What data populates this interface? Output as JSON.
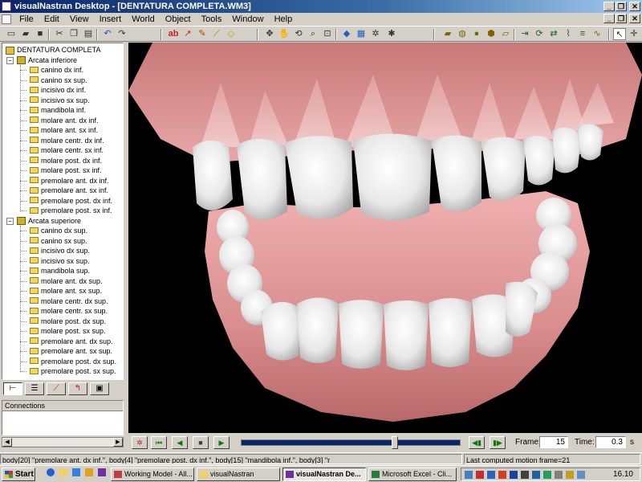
{
  "window": {
    "title": "visualNastran Desktop - [DENTATURA COMPLETA.WM3]",
    "controls": [
      "_",
      "❐",
      "✕"
    ]
  },
  "menubar": {
    "items": [
      "File",
      "Edit",
      "View",
      "Insert",
      "World",
      "Object",
      "Tools",
      "Window",
      "Help"
    ],
    "doc_controls": [
      "_",
      "❐",
      "✕"
    ]
  },
  "tree": {
    "root": "DENTATURA COMPLETA",
    "groups": [
      {
        "label": "Arcata inferiore",
        "items": [
          "canino dx inf.",
          "canino sx sup.",
          "incisivo dx inf.",
          "incisivo sx sup.",
          "mandibola inf.",
          "molare ant. dx inf.",
          "molare ant. sx inf.",
          "molare centr. dx inf.",
          "molare centr. sx inf.",
          "molare post. dx inf.",
          "molare post. sx inf.",
          "premolare ant. dx inf.",
          "premolare ant. sx inf.",
          "premolare post. dx inf.",
          "premolare post. sx inf."
        ]
      },
      {
        "label": "Arcata superiore",
        "items": [
          "canino dx sup.",
          "canino sx sup.",
          "incisivo dx sup.",
          "incisivo sx sup.",
          "mandibola sup.",
          "molare ant. dx sup.",
          "molare ant. sx sup.",
          "molare centr. dx sup.",
          "molare centr. sx sup.",
          "molare post. dx sup.",
          "molare post. sx sup.",
          "premolare ant. dx sup.",
          "premolare ant. sx sup.",
          "premolare post. dx sup.",
          "premolare post. sx sup."
        ]
      }
    ]
  },
  "connections": {
    "header": "Connections"
  },
  "animation": {
    "frame_label": "Frame:",
    "frame_value": "15",
    "time_label": "Time:",
    "time_value": "0.3",
    "time_unit": "s",
    "progress": 0.71
  },
  "status": {
    "left": "body[20] \"premolare ant. dx inf.\", body[4] \"premolare post. dx inf.\", body[15] \"mandibola inf.\", body[3] \"r",
    "right": "Last computed motion frame=21"
  },
  "taskbar": {
    "start": "Start",
    "tasks": [
      "Working Model - All...",
      "visualNastran",
      "visualNastran De...",
      "Microsoft Excel - Cli..."
    ],
    "active_task": 2,
    "clock": "16.10"
  },
  "colors": {
    "titlebar": "#0a246a",
    "viewport_bg": "#000000",
    "gum": "#e09a9a",
    "tooth": "#f2f2f2",
    "track": "#0a246a"
  }
}
